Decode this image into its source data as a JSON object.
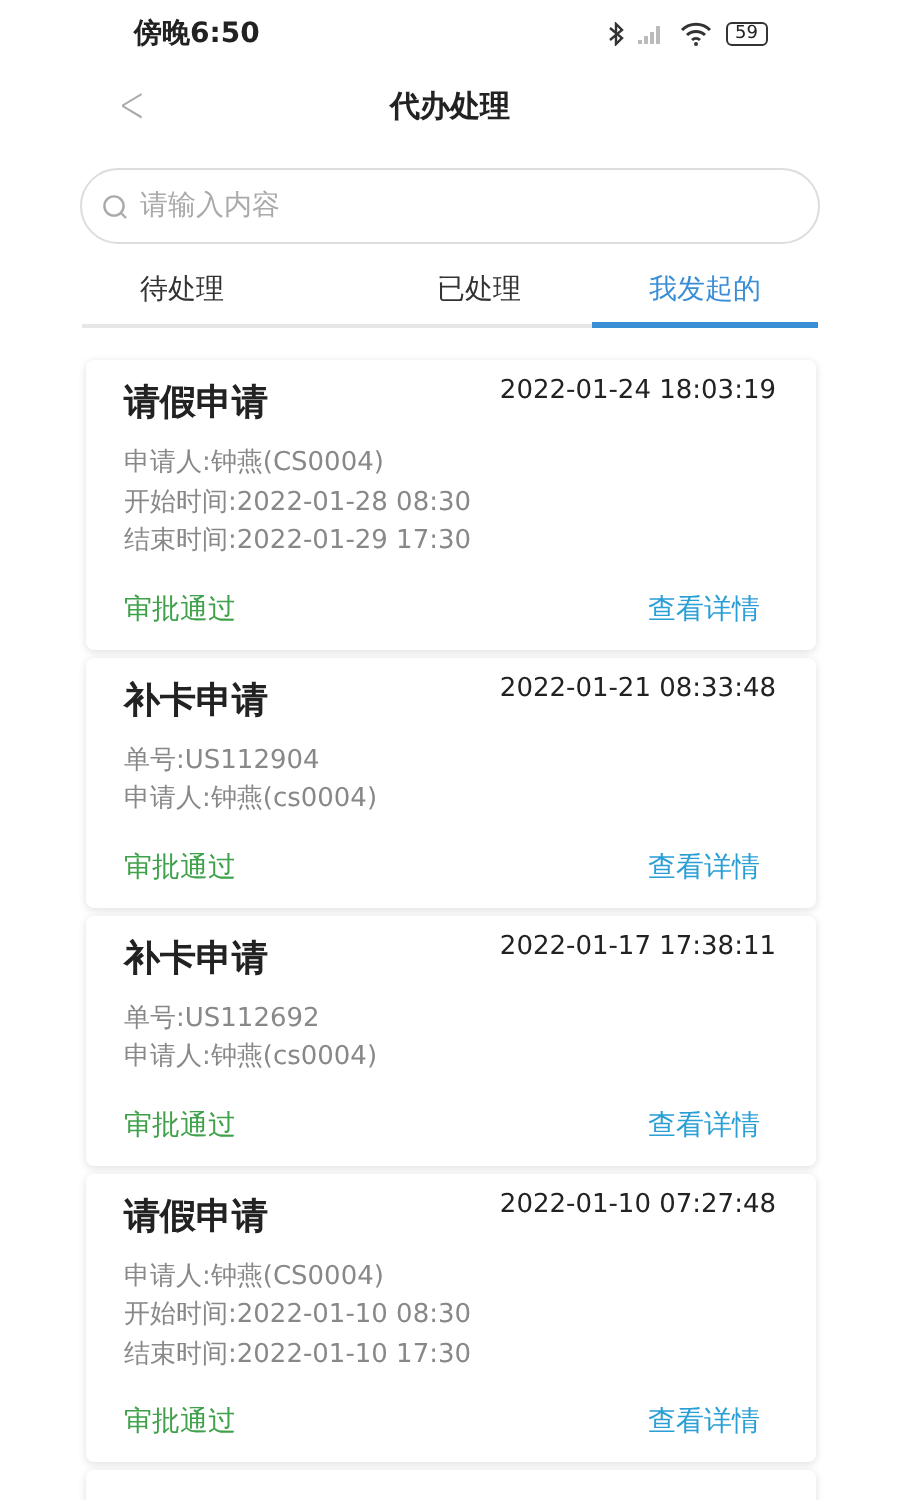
{
  "status_bar": {
    "time": "傍晚6:50",
    "battery": "59"
  },
  "header": {
    "back": "<",
    "title": "代办处理"
  },
  "search": {
    "placeholder": "请输入内容"
  },
  "tabs": [
    {
      "label": "待处理",
      "selected": false
    },
    {
      "label": "已处理",
      "selected": false
    },
    {
      "label": "我发起的",
      "selected": true
    }
  ],
  "cards": [
    {
      "title": "请假申请",
      "time": "2022-01-24 18:03:19",
      "fields": [
        "申请人:钟燕(CS0004)",
        "开始时间:2022-01-28 08:30",
        "结束时间:2022-01-29 17:30"
      ],
      "status": "审批通过",
      "action": "查看详情"
    },
    {
      "title": "补卡申请",
      "time": "2022-01-21 08:33:48",
      "fields": [
        "单号:US112904",
        "申请人:钟燕(cs0004)"
      ],
      "status": "审批通过",
      "action": "查看详情"
    },
    {
      "title": "补卡申请",
      "time": "2022-01-17 17:38:11",
      "fields": [
        "单号:US112692",
        "申请人:钟燕(cs0004)"
      ],
      "status": "审批通过",
      "action": "查看详情"
    },
    {
      "title": "请假申请",
      "time": "2022-01-10 07:27:48",
      "fields": [
        "申请人:钟燕(CS0004)",
        "开始时间:2022-01-10 08:30",
        "结束时间:2022-01-10 17:30"
      ],
      "status": "审批通过",
      "action": "查看详情"
    }
  ]
}
